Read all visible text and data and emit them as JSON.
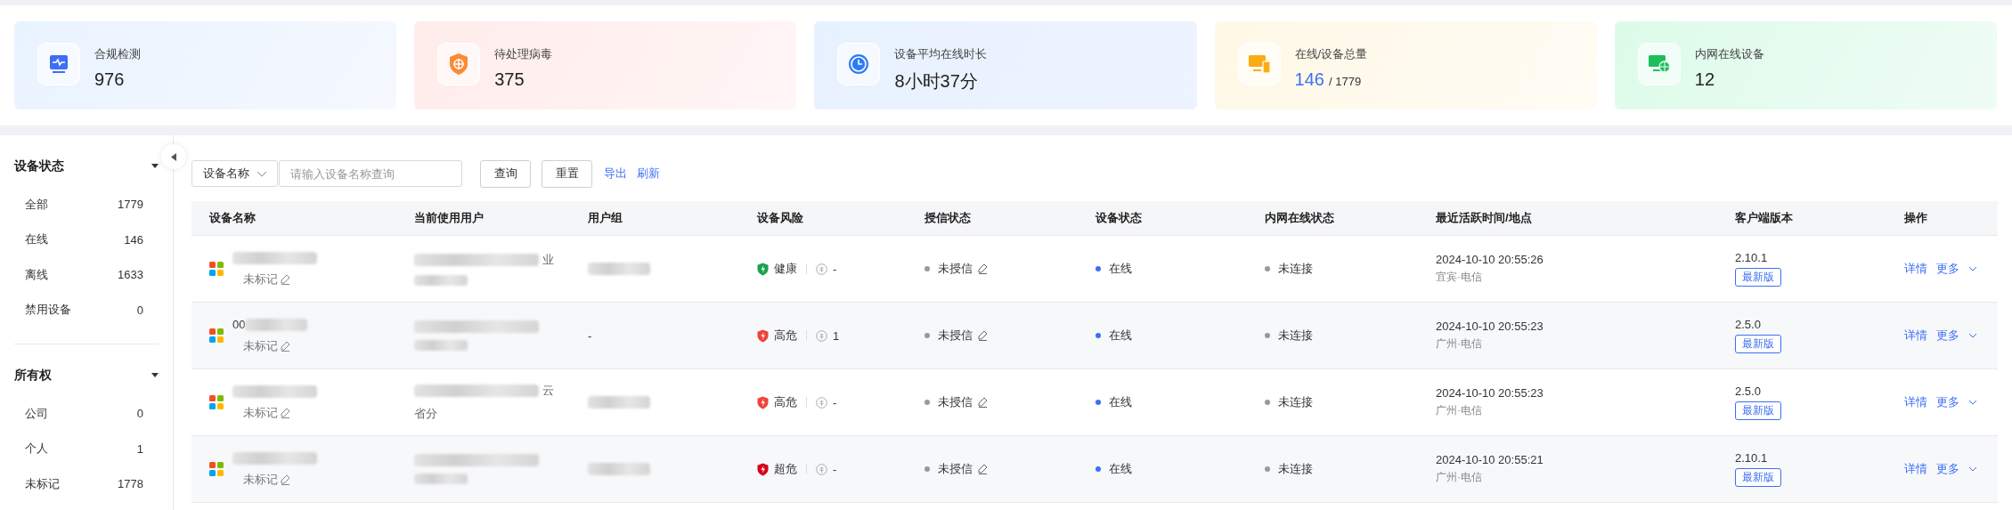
{
  "stats": [
    {
      "kind": "monitor",
      "label": "合规检测",
      "value": "976"
    },
    {
      "kind": "shield",
      "label": "待处理病毒",
      "value": "375"
    },
    {
      "kind": "clock",
      "label": "设备平均在线时长",
      "value": "8小时37分"
    },
    {
      "kind": "devices",
      "label": "在线/设备总量",
      "value": "146",
      "total": "/ 1779"
    },
    {
      "kind": "network",
      "label": "内网在线设备",
      "value": "12"
    }
  ],
  "sidebar": [
    {
      "title": "设备状态",
      "expanded": true,
      "items": [
        {
          "label": "全部",
          "count": "1779"
        },
        {
          "label": "在线",
          "count": "146"
        },
        {
          "label": "离线",
          "count": "1633"
        },
        {
          "label": "禁用设备",
          "count": "0"
        }
      ]
    },
    {
      "title": "所有权",
      "expanded": true,
      "items": [
        {
          "label": "公司",
          "count": "0"
        },
        {
          "label": "个人",
          "count": "1"
        },
        {
          "label": "未标记",
          "count": "1778"
        }
      ]
    }
  ],
  "toolbar": {
    "field_select": "设备名称",
    "search": {
      "placeholder": "请输入设备名称查询"
    },
    "buttons": [
      "查询",
      "重置"
    ],
    "links": [
      "导出",
      "刷新"
    ]
  },
  "table": {
    "columns": [
      "设备名称",
      "当前使用用户",
      "用户组",
      "设备风险",
      "授信状态",
      "设备状态",
      "内网在线状态",
      "最近活跃时间/地点",
      "客户端版本",
      "操作"
    ],
    "rows": [
      {
        "name_prefix": "",
        "tag": "未标记",
        "user_fragments": [
          "业"
        ],
        "group": "",
        "risk": {
          "label": "健康",
          "color": "#18a34a"
        },
        "vulns": "-",
        "auth": "未授信",
        "status": {
          "label": "在线",
          "color": "#3b6ff5"
        },
        "intranet": "未连接",
        "time": "2024-10-10 20:55:26",
        "place": "宜宾·电信",
        "version": "2.10.1",
        "version_tag": "最新版",
        "actions": [
          "详情",
          "更多"
        ]
      },
      {
        "name_prefix": "00",
        "tag": "未标记",
        "user_fragments": [],
        "group": "-",
        "risk": {
          "label": "高危",
          "color": "#f0433a"
        },
        "vulns": "1",
        "auth": "未授信",
        "status": {
          "label": "在线",
          "color": "#3b6ff5"
        },
        "intranet": "未连接",
        "time": "2024-10-10 20:55:23",
        "place": "广州·电信",
        "version": "2.5.0",
        "version_tag": "最新版",
        "actions": [
          "详情",
          "更多"
        ]
      },
      {
        "name_prefix": "",
        "tag": "未标记",
        "user_fragments": [
          "云",
          "省分"
        ],
        "group": "",
        "risk": {
          "label": "高危",
          "color": "#f0433a"
        },
        "vulns": "-",
        "auth": "未授信",
        "status": {
          "label": "在线",
          "color": "#3b6ff5"
        },
        "intranet": "未连接",
        "time": "2024-10-10 20:55:23",
        "place": "广州·电信",
        "version": "2.5.0",
        "version_tag": "最新版",
        "actions": [
          "详情",
          "更多"
        ]
      },
      {
        "name_prefix": "",
        "tag": "未标记",
        "user_fragments": [],
        "group": "",
        "risk": {
          "label": "超危",
          "color": "#d9001b"
        },
        "vulns": "-",
        "auth": "未授信",
        "status": {
          "label": "在线",
          "color": "#3b6ff5"
        },
        "intranet": "未连接",
        "time": "2024-10-10 20:55:21",
        "place": "广州·电信",
        "version": "2.10.1",
        "version_tag": "最新版",
        "actions": [
          "详情",
          "更多"
        ]
      }
    ]
  }
}
